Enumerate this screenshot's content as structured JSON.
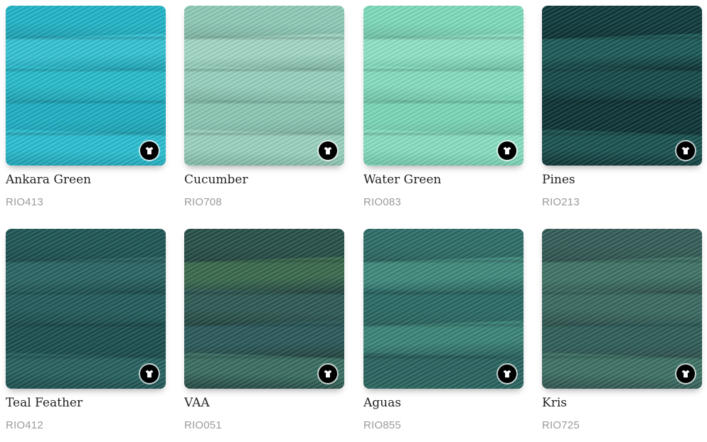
{
  "products": [
    {
      "name": "Ankara Green",
      "code": "RIO413",
      "colors": [
        "#22b6c9",
        "#35c4d6",
        "#29bccd",
        "#1eb0c4",
        "#2cbfd2"
      ],
      "icon": "tshirt-icon"
    },
    {
      "name": "Cucumber",
      "code": "RIO708",
      "colors": [
        "#8fcbb8",
        "#a3d8c6",
        "#98d1bf",
        "#8cc8b5",
        "#9cd3c1"
      ],
      "icon": "tshirt-icon"
    },
    {
      "name": "Water Green",
      "code": "RIO083",
      "colors": [
        "#7fdcbc",
        "#8fe3c6",
        "#86dfc1",
        "#7ad8b8",
        "#89e0c2"
      ],
      "icon": "tshirt-icon"
    },
    {
      "name": "Pines",
      "code": "RIO213",
      "colors": [
        "#0f3a3c",
        "#1c5a58",
        "#164a4a",
        "#0d3436",
        "#1a5250"
      ],
      "icon": "tshirt-icon"
    },
    {
      "name": "Teal Feather",
      "code": "RIO412",
      "colors": [
        "#1f5656",
        "#2a6564",
        "#235c5c",
        "#1b4f50",
        "#276160"
      ],
      "icon": "tshirt-icon"
    },
    {
      "name": "VAA",
      "code": "RIO051",
      "colors": [
        "#28504a",
        "#3a6a4e",
        "#2f5a55",
        "#2b5a5c",
        "#3a6e62"
      ],
      "icon": "tshirt-icon"
    },
    {
      "name": "Aguas",
      "code": "RIO855",
      "colors": [
        "#2e6e68",
        "#3f8a7c",
        "#2a6a66",
        "#3b8478",
        "#296360"
      ],
      "icon": "tshirt-icon"
    },
    {
      "name": "Kris",
      "code": "RIO725",
      "colors": [
        "#355d58",
        "#3f7466",
        "#3a6a62",
        "#2f5f5a",
        "#3e7265"
      ],
      "icon": "tshirt-icon"
    }
  ]
}
